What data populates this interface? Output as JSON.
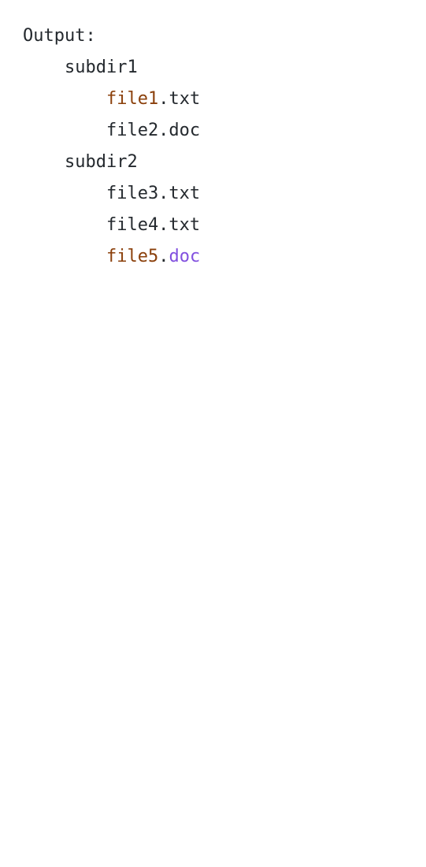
{
  "code": {
    "lines": [
      {
        "text": "Output:"
      },
      {
        "text": "    subdir1"
      },
      {
        "indent": "        ",
        "name": "file1",
        "dot": ".",
        "ext": "txt"
      },
      {
        "text": "        file2.doc"
      },
      {
        "text": "    subdir2"
      },
      {
        "text": "        file3.txt"
      },
      {
        "text": "        file4.txt"
      },
      {
        "indent": "        ",
        "name": "file5",
        "dot": ".",
        "ext": "doc"
      }
    ]
  },
  "colors": {
    "text": "#24292e",
    "highlight_name": "#8a3f0a",
    "highlight_ext": "#8250df"
  }
}
